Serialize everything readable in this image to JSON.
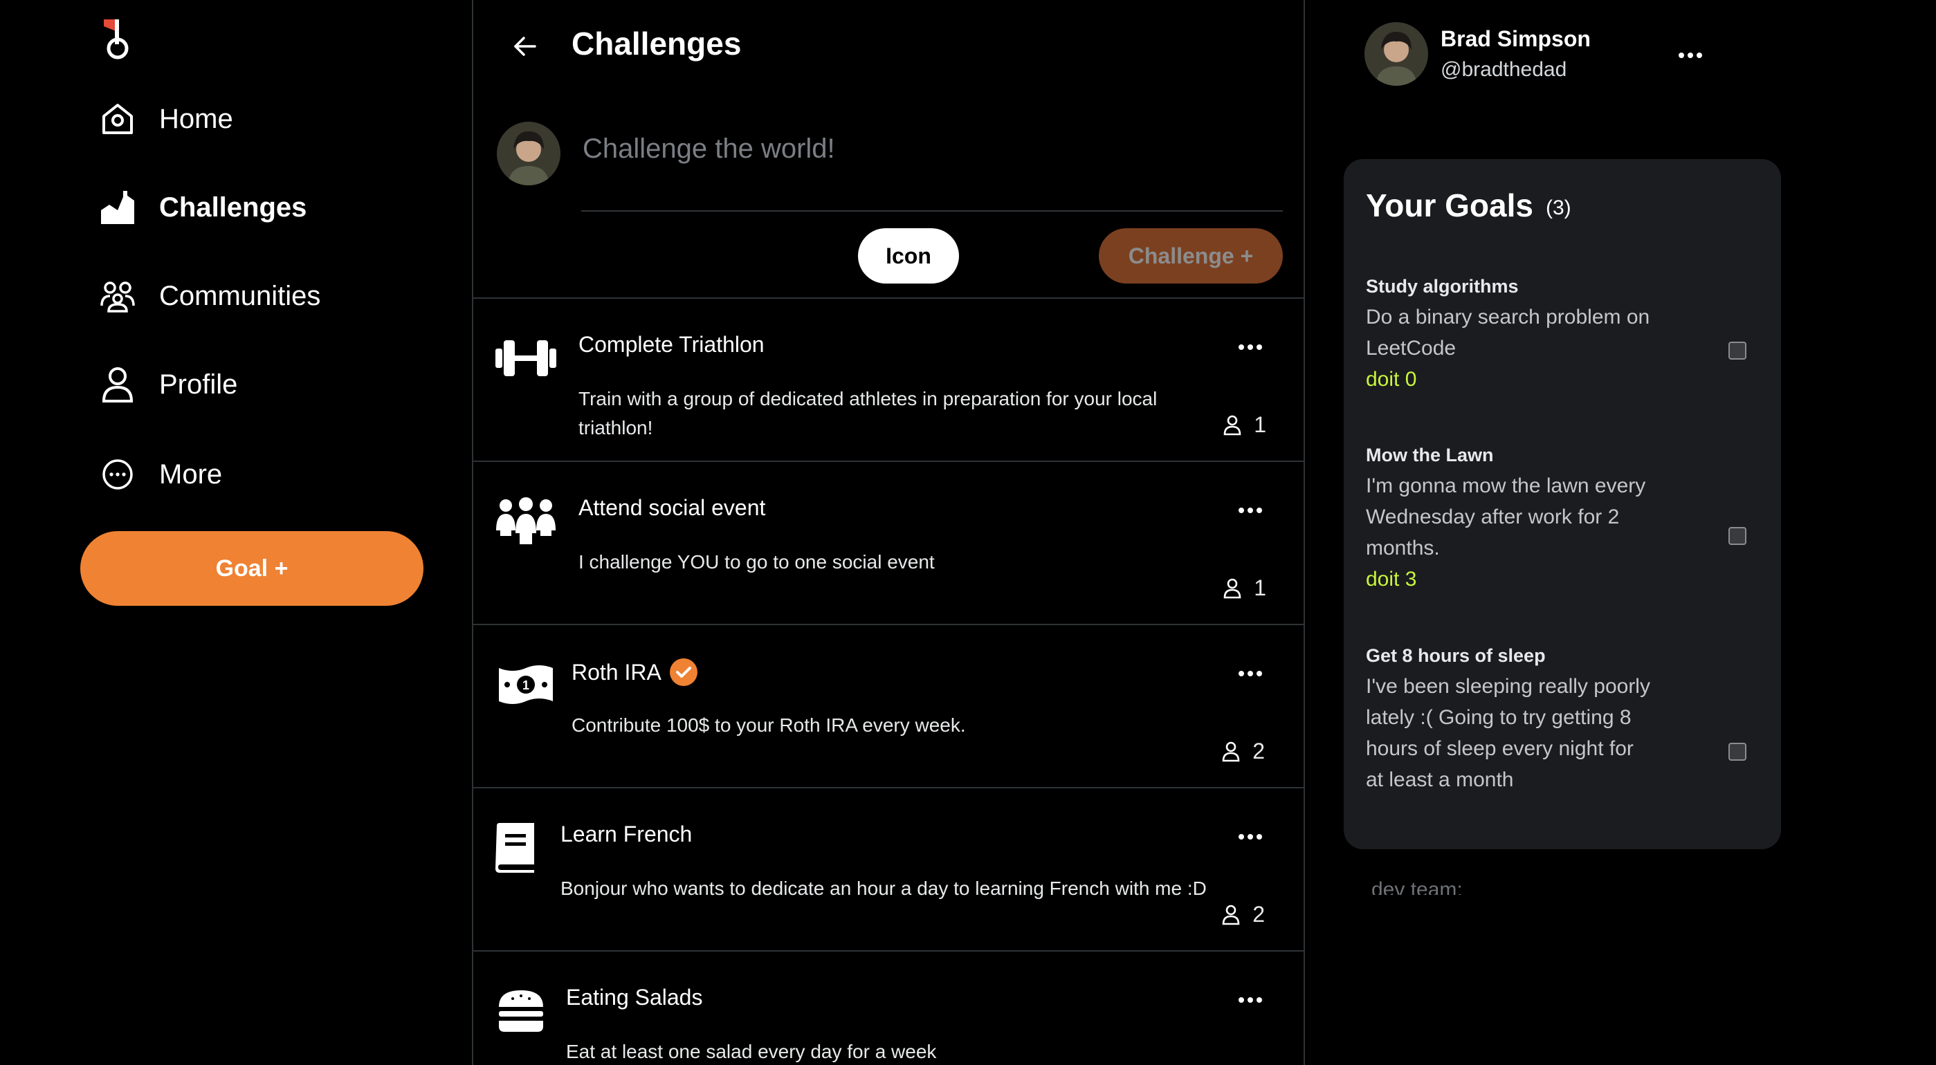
{
  "nav": {
    "items": [
      {
        "label": "Home"
      },
      {
        "label": "Challenges"
      },
      {
        "label": "Communities"
      },
      {
        "label": "Profile"
      },
      {
        "label": "More"
      }
    ],
    "goal_button": "Goal +"
  },
  "header": {
    "title": "Challenges"
  },
  "composer": {
    "placeholder": "Challenge the world!",
    "icon_button": "Icon",
    "challenge_button": "Challenge +"
  },
  "challenges": [
    {
      "icon": "dumbbell-icon",
      "title": "Complete Triathlon",
      "description": "Train with a group of dedicated athletes in preparation for your local triathlon!",
      "count": "1",
      "verified": false
    },
    {
      "icon": "people-group-icon",
      "title": "Attend social event",
      "description": "I challenge YOU to go to one social event",
      "count": "1",
      "verified": false
    },
    {
      "icon": "money-bill-icon",
      "title": "Roth IRA",
      "description": "Contribute 100$ to your Roth IRA every week.",
      "count": "2",
      "verified": true
    },
    {
      "icon": "book-icon",
      "title": "Learn French",
      "description": "Bonjour who wants to dedicate an hour a day to learning French with me :D",
      "count": "2",
      "verified": false
    },
    {
      "icon": "burger-icon",
      "title": "Eating Salads",
      "description": "Eat at least one salad every day for a week",
      "count": "",
      "verified": false
    }
  ],
  "user": {
    "name": "Brad Simpson",
    "handle": "@bradthedad"
  },
  "goals": {
    "title": "Your Goals",
    "count": "(3)",
    "items": [
      {
        "title": "Study algorithms",
        "description": "Do a binary search problem on LeetCode",
        "doit": "doit 0",
        "checked": false
      },
      {
        "title": "Mow the Lawn",
        "description": "I'm gonna mow the lawn every Wednesday after work for 2 months.",
        "doit": "doit 3",
        "checked": false
      },
      {
        "title": "Get 8 hours of sleep",
        "description": "I've been sleeping really poorly lately :( Going to try getting 8 hours of sleep every night for at least a month",
        "doit": "",
        "checked": false
      }
    ]
  },
  "footer": {
    "devteam": "dev team:"
  },
  "colors": {
    "accent": "#ef8233",
    "doit": "#c8f53c",
    "panel": "#1b1c1f"
  }
}
